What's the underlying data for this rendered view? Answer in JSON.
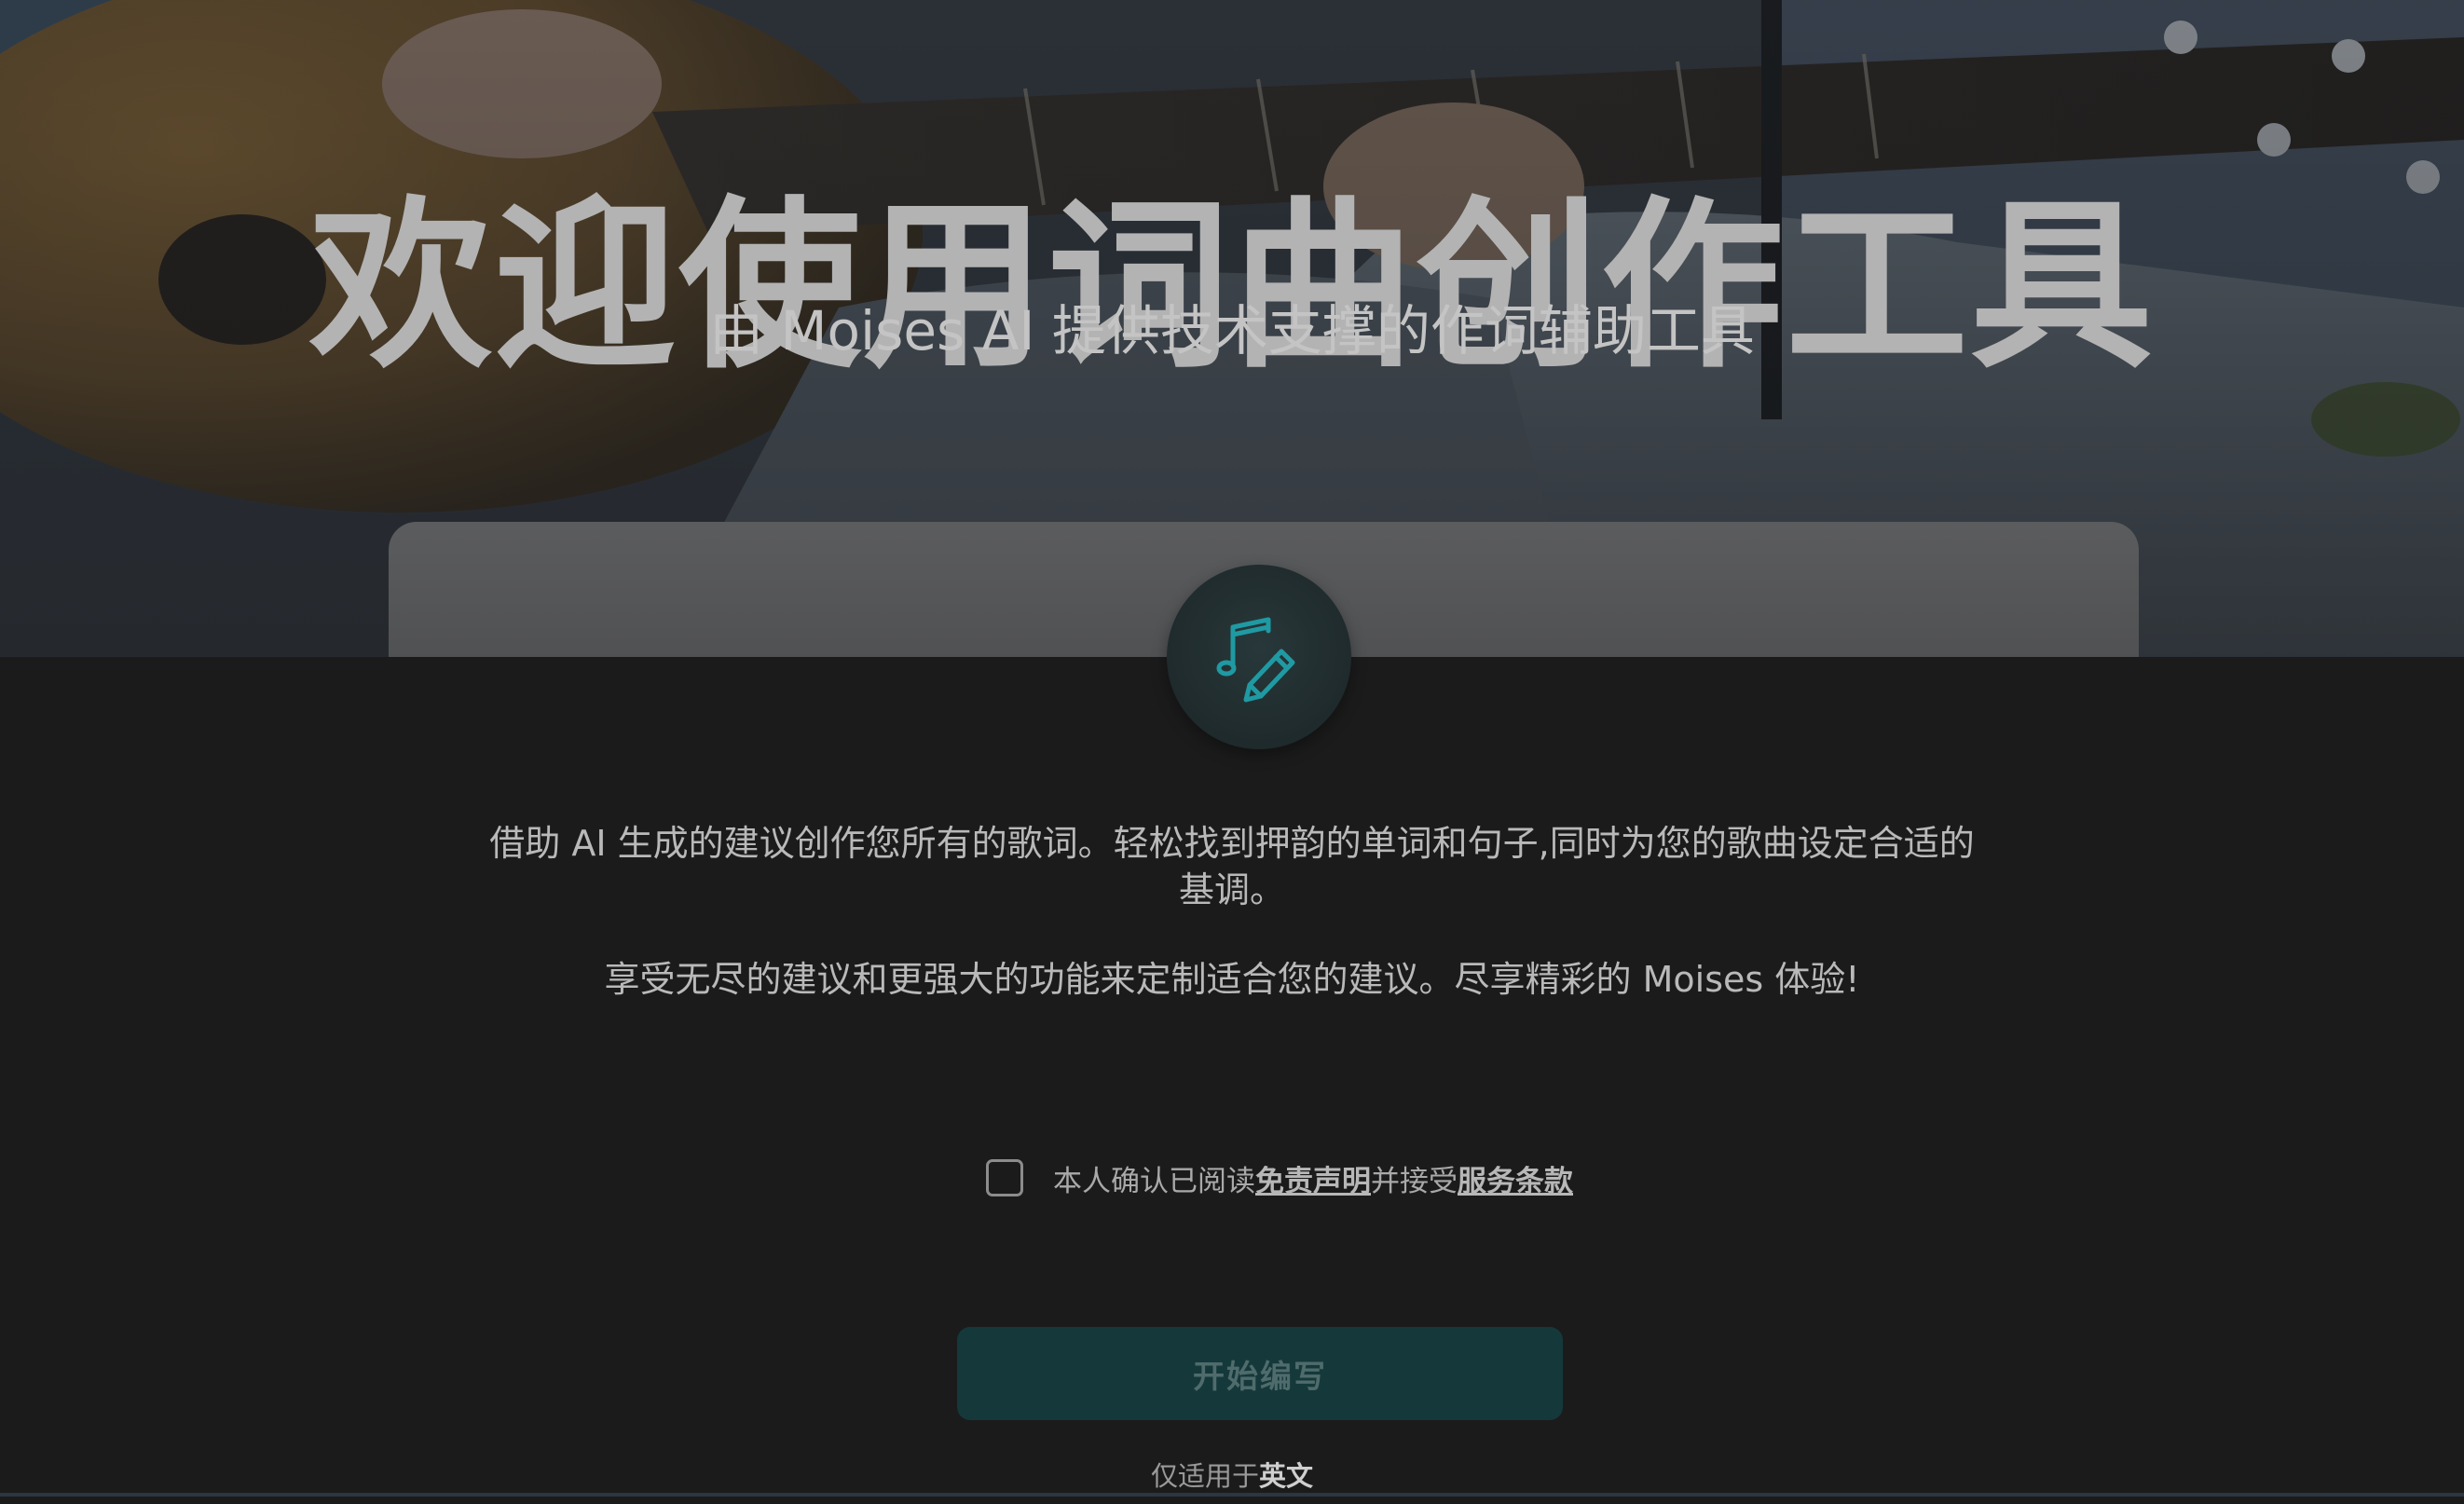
{
  "hero": {
    "title": "欢迎使用词曲创作工具",
    "subtitle": "由 Moises AI 提供技术支撑的作词辅助工具"
  },
  "icon": {
    "name": "music-note-pencil-icon",
    "color": "#1f9aa3"
  },
  "description": {
    "paragraph1": "借助 AI 生成的建议创作您所有的歌词。轻松找到押韵的单词和句子,同时为您的歌曲设定合适的基调。",
    "paragraph2": "享受无尽的建议和更强大的功能来定制适合您的建议。尽享精彩的 Moises 体验!"
  },
  "consent": {
    "checked": false,
    "prefix": "本人确认已阅读",
    "disclaimer_link": "免责声明",
    "middle": "并接受",
    "terms_link": "服务条款"
  },
  "start_button": {
    "label": "开始编写",
    "enabled": false
  },
  "language_note": {
    "prefix": "仅适用于",
    "language": "英文"
  },
  "colors": {
    "background": "#1b1b1c",
    "accent": "#15393a",
    "accent_text": "#4f6b6c"
  }
}
